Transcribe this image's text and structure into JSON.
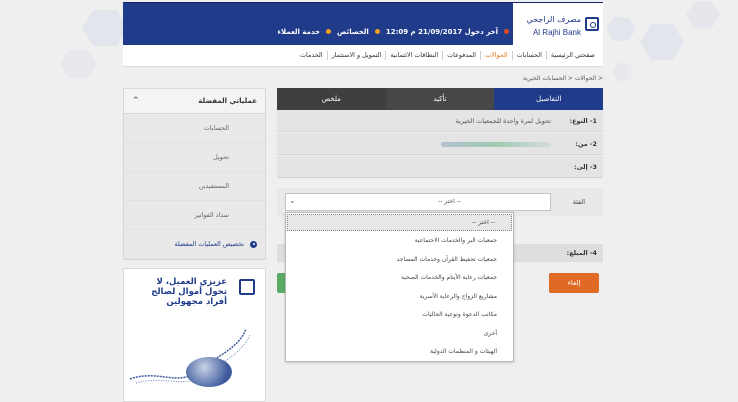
{
  "header": {
    "logo_ar": "مصرف الراجحي",
    "logo_en": "Al Rajhi Bank",
    "last_login": "آخر دخول 21/09/2017 م 12:09",
    "features": "الخصائص",
    "customer_service": "خدمة العملاء",
    "brand_color": "#1f3b8a"
  },
  "nav": {
    "items": [
      {
        "label": "صفحتي الرئيسية"
      },
      {
        "label": "الحسابات"
      },
      {
        "label": "الحوالات"
      },
      {
        "label": "المدفوعات"
      },
      {
        "label": "البطاقات الائتمانية"
      },
      {
        "label": "التمويل و الاستثمار"
      },
      {
        "label": "الخدمات"
      }
    ],
    "active_index": 2
  },
  "breadcrumb": "< الحوالات < الحسابات الخيرية",
  "sidebar": {
    "title": "عملياتي المفضلة",
    "items": [
      {
        "label": "الحسابات"
      },
      {
        "label": "تحويل"
      },
      {
        "label": "المستفيدين"
      },
      {
        "label": "سداد الفواتير"
      }
    ],
    "customize": "تخصيص العمليات المفضلة"
  },
  "ad": {
    "text": "عزيزي العميل، لا تحول أموال لصالح أفراد مجهولين"
  },
  "steps": [
    {
      "label": "التفاصيل",
      "active": true
    },
    {
      "label": "تأكيد",
      "active": false
    },
    {
      "label": "ملخص",
      "active": false
    }
  ],
  "form": {
    "type_label": "1- النوع:",
    "type_value": "تحويل لمرة واحدة للجمعيات الخيرية",
    "from_label": "2- من:",
    "to_label": "3- إلى:",
    "category_label": "الفئة",
    "category_selected": "-- اختر --",
    "amount_label": "4- المبلغ:",
    "cancel": "إلغاء"
  },
  "dropdown": {
    "options": [
      "-- اختر --",
      "جمعيات البر والخدمات الاجتماعية",
      "جمعيات تحفيظ القرآن وخدمات المساجد",
      "جمعيات رعاية الأيتام والخدمات الصحية",
      "مشاريع الزواج والرعاية الأسرية",
      "مكاتب الدعوة وتوعية الجاليات",
      "أخرى",
      "الهيئات و المنظمات الدولية"
    ],
    "highlighted_index": 0
  }
}
